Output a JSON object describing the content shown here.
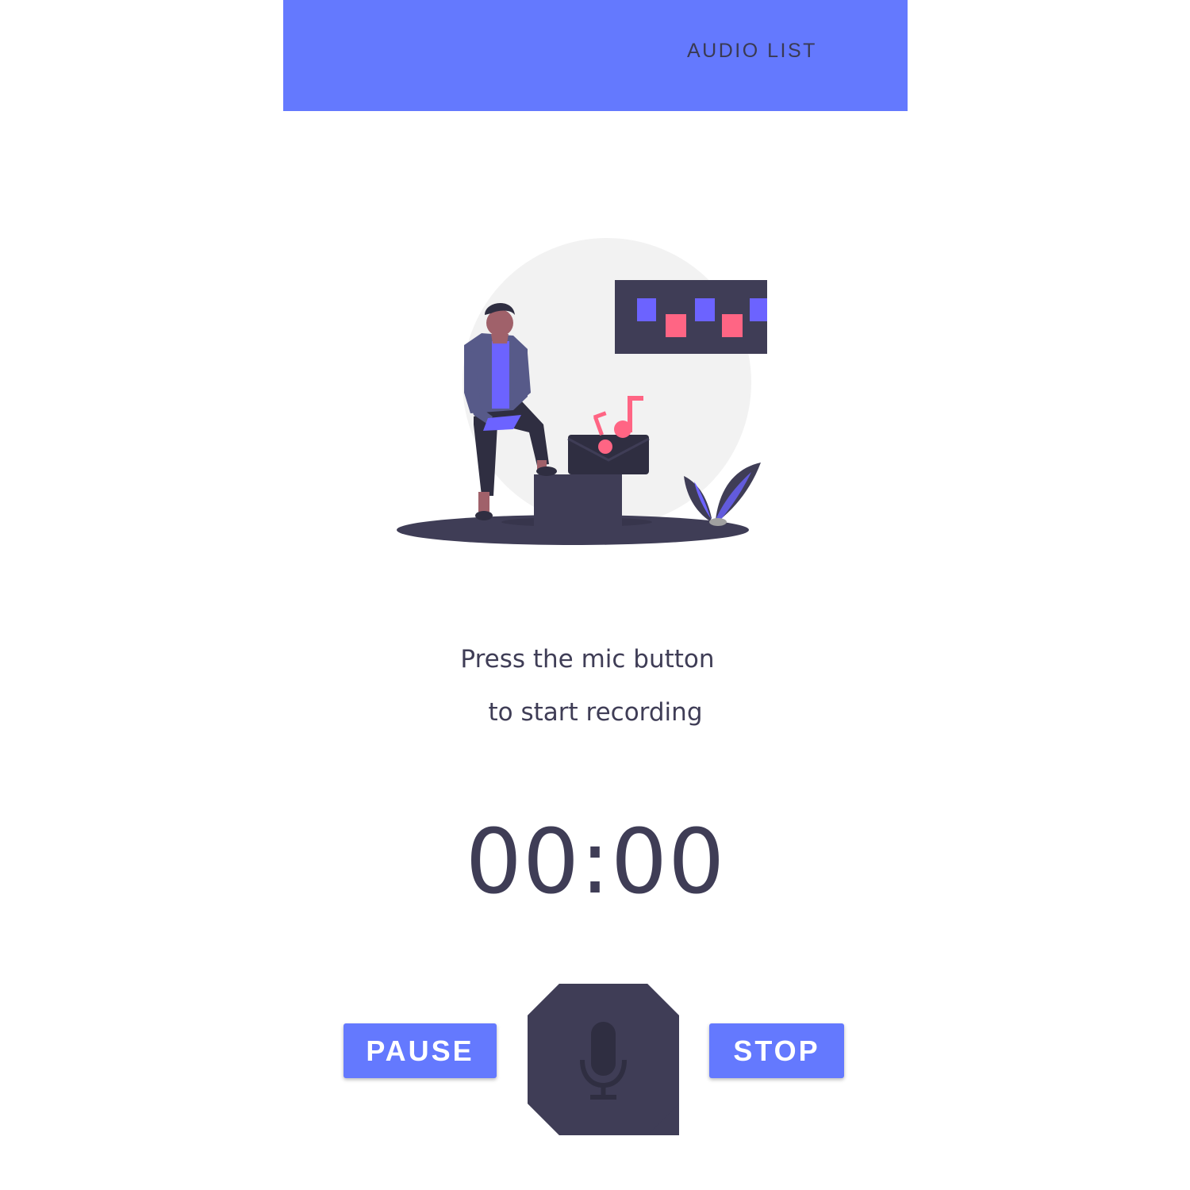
{
  "app_bar": {
    "action_label": "AUDIO LIST",
    "color": "#6479fe"
  },
  "prompt": {
    "line1": "Press the mic button",
    "line2": "to start recording"
  },
  "timer": {
    "value": "00:00"
  },
  "controls": {
    "pause_label": "PAUSE",
    "stop_label": "STOP",
    "mic_icon": "microphone-icon",
    "button_color": "#6479fe",
    "mic_button_color": "#3f3d56"
  },
  "illustration": {
    "icon": "person-recording-music-illustration",
    "accent_colors": [
      "#6c63ff",
      "#ff6584",
      "#3f3d56"
    ]
  }
}
